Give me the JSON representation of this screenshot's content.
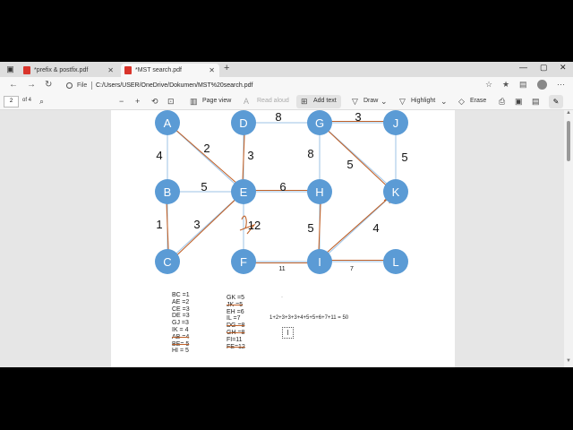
{
  "tabs": [
    {
      "title": "*prefix & postfix.pdf"
    },
    {
      "title": "*MST search.pdf"
    }
  ],
  "address": {
    "scheme_label": "File",
    "url": "C:/Users/USER/OneDrive/Dokumen/MST%20search.pdf"
  },
  "pdf_toolbar": {
    "page_number": "2",
    "page_count": "of 4",
    "page_view": "Page view",
    "read_aloud": "Read aloud",
    "add_text": "Add text",
    "draw": "Draw",
    "highlight": "Highlight",
    "erase": "Erase"
  },
  "graph": {
    "nodes": [
      "A",
      "D",
      "G",
      "J",
      "B",
      "E",
      "H",
      "K",
      "C",
      "F",
      "I",
      "L"
    ],
    "edge_weights": {
      "AB": "4",
      "AE": "2",
      "DE": "3",
      "DG": "8",
      "GJ": "3",
      "GH": "8",
      "GK": "5",
      "JK": "5",
      "BE": "5",
      "EH": "6",
      "BC": "1",
      "CE": "3",
      "EF": "12",
      "HI": "5",
      "IK": "4",
      "FI": "11",
      "IL": "7"
    },
    "mst_edges": [
      "AE",
      "DE",
      "GJ",
      "GK",
      "BC",
      "CE",
      "EH",
      "HI",
      "IK",
      "FI",
      "IL"
    ]
  },
  "weights_list_left": [
    {
      "text": "BC =1",
      "struck": false
    },
    {
      "text": "AE =2",
      "struck": false
    },
    {
      "text": "CE =3",
      "struck": false
    },
    {
      "text": "DE =3",
      "struck": false
    },
    {
      "text": "GJ =3",
      "struck": false
    },
    {
      "text": "IK = 4",
      "struck": false
    },
    {
      "text": "AB =4",
      "struck": true
    },
    {
      "text": "BE= 5",
      "struck": true
    },
    {
      "text": "HI = 5",
      "struck": false
    }
  ],
  "weights_list_right": [
    {
      "text": "GK =5",
      "struck": false
    },
    {
      "text": "JK =5",
      "struck": true
    },
    {
      "text": "EH =6",
      "struck": false
    },
    {
      "text": "IL =7",
      "struck": false
    },
    {
      "text": "DG =8",
      "struck": true
    },
    {
      "text": "GH =8",
      "struck": true
    },
    {
      "text": "FI=11",
      "struck": false
    },
    {
      "text": "FE=12",
      "struck": true
    }
  ],
  "sum_text": "1+2+3+3+3+4+5+5+6+7+11 = 50",
  "colors": {
    "node": "#5b9bd5",
    "edge": "#9dc3e6",
    "ink": "#c0622a"
  }
}
